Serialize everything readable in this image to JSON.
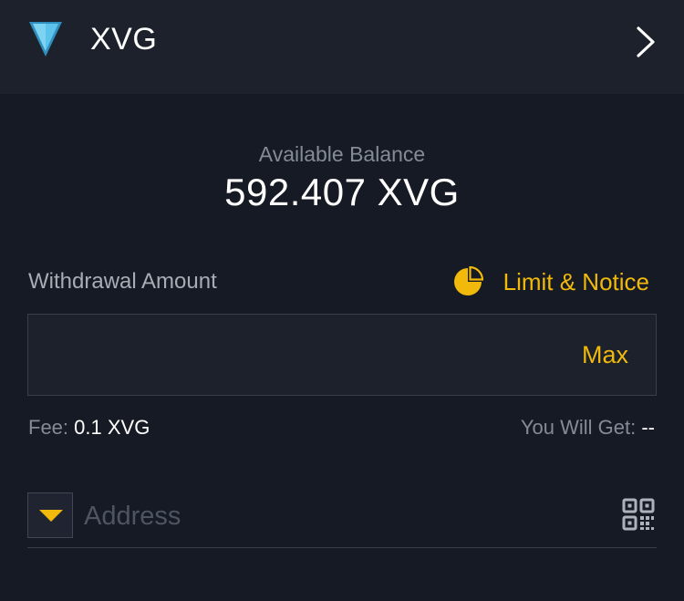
{
  "header": {
    "coin_symbol": "XVG",
    "logo_icon": "verge-logo-icon",
    "chevron_icon": "chevron-right-icon"
  },
  "balance": {
    "label": "Available Balance",
    "value": "592.407 XVG"
  },
  "withdraw": {
    "label": "Withdrawal Amount",
    "limit_notice_label": "Limit & Notice",
    "limit_icon": "pie-chart-icon",
    "amount_value": "",
    "max_label": "Max"
  },
  "fee": {
    "label": "Fee:",
    "value": "0.1 XVG",
    "you_will_get_label": "You Will Get:",
    "you_will_get_value": "--"
  },
  "address": {
    "placeholder": "Address",
    "dropdown_icon": "caret-down-icon",
    "qr_icon": "qr-code-icon"
  },
  "colors": {
    "accent": "#f0b90b",
    "background": "#161a24",
    "header_background": "#1c212b",
    "logo_blue": "#4fb6e0"
  }
}
